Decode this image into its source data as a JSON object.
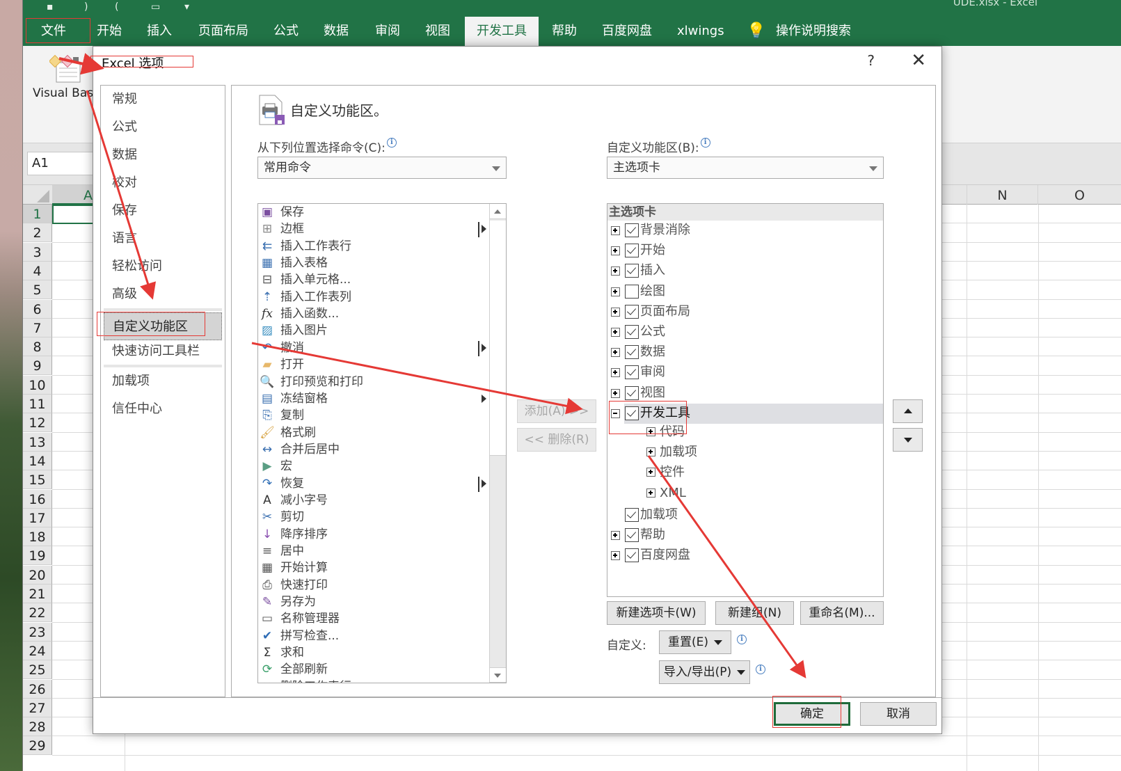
{
  "window": {
    "title_fragment": "UDE.xlsx  -  Excel"
  },
  "ribbon": {
    "tabs": [
      {
        "label": "文件"
      },
      {
        "label": "开始"
      },
      {
        "label": "插入"
      },
      {
        "label": "页面布局"
      },
      {
        "label": "公式"
      },
      {
        "label": "数据"
      },
      {
        "label": "审阅"
      },
      {
        "label": "视图"
      },
      {
        "label": "开发工具",
        "active": true
      },
      {
        "label": "帮助"
      },
      {
        "label": "百度网盘"
      },
      {
        "label": "xlwings"
      }
    ],
    "tell_me": "操作说明搜索",
    "visual_basic_label": "Visual Basi"
  },
  "sheet": {
    "name_box": "A1",
    "columns_left": [
      "A"
    ],
    "columns_right": [
      "N",
      "O"
    ],
    "rows": [
      "1",
      "2",
      "3",
      "4",
      "5",
      "6",
      "7",
      "8",
      "9",
      "10",
      "11",
      "12",
      "13",
      "14",
      "15",
      "16",
      "17",
      "18",
      "19",
      "20",
      "21",
      "22",
      "23",
      "24",
      "25",
      "26",
      "27",
      "28",
      "29"
    ]
  },
  "dialog": {
    "title": "Excel 选项",
    "help": "?",
    "close": "✕",
    "nav": [
      {
        "label": "常规"
      },
      {
        "label": "公式"
      },
      {
        "label": "数据"
      },
      {
        "label": "校对"
      },
      {
        "label": "保存"
      },
      {
        "label": "语言"
      },
      {
        "label": "轻松访问"
      },
      {
        "label": "高级"
      },
      {
        "label": "自定义功能区",
        "active": true
      },
      {
        "label": "快速访问工具栏"
      },
      {
        "label": "加载项"
      },
      {
        "label": "信任中心"
      }
    ],
    "section_title": "自定义功能区。",
    "choose_commands_label": "从下列位置选择命令(C):",
    "choose_commands_value": "常用命令",
    "customize_ribbon_label": "自定义功能区(B):",
    "customize_ribbon_value": "主选项卡",
    "commands": [
      {
        "label": "保存",
        "icon": "save-icon",
        "glyph": "▣",
        "color": "#7b4fa0"
      },
      {
        "label": "边框",
        "icon": "borders-icon",
        "glyph": "⊞",
        "color": "#888",
        "submenu": "bar"
      },
      {
        "label": "插入工作表行",
        "icon": "insert-row-icon",
        "glyph": "⇇",
        "color": "#3a6fb0"
      },
      {
        "label": "插入表格",
        "icon": "insert-table-icon",
        "glyph": "▦",
        "color": "#3a6fb0"
      },
      {
        "label": "插入单元格...",
        "icon": "insert-cells-icon",
        "glyph": "⊟",
        "color": "#555"
      },
      {
        "label": "插入工作表列",
        "icon": "insert-column-icon",
        "glyph": "⇡",
        "color": "#3a6fb0"
      },
      {
        "label": "插入函数...",
        "icon": "function-icon",
        "glyph": "fx",
        "color": "#333"
      },
      {
        "label": "插入图片",
        "icon": "picture-icon",
        "glyph": "▨",
        "color": "#3a8fc0"
      },
      {
        "label": "撤消",
        "icon": "undo-icon",
        "glyph": "↶",
        "color": "#2f6db5",
        "submenu": "bar"
      },
      {
        "label": "打开",
        "icon": "folder-icon",
        "glyph": "▰",
        "color": "#e7b86a"
      },
      {
        "label": "打印预览和打印",
        "icon": "print-preview-icon",
        "glyph": "🔍",
        "color": "#555"
      },
      {
        "label": "冻结窗格",
        "icon": "freeze-panes-icon",
        "glyph": "▤",
        "color": "#3a6fb0",
        "submenu": "plain"
      },
      {
        "label": "复制",
        "icon": "copy-icon",
        "glyph": "⎘",
        "color": "#3a6fb0"
      },
      {
        "label": "格式刷",
        "icon": "format-painter-icon",
        "glyph": "🖌",
        "color": "#d9a84d"
      },
      {
        "label": "合并后居中",
        "icon": "merge-center-icon",
        "glyph": "↔",
        "color": "#3a6fb0"
      },
      {
        "label": "宏",
        "icon": "macro-icon",
        "glyph": "▶",
        "color": "#5b9e84"
      },
      {
        "label": "恢复",
        "icon": "redo-icon",
        "glyph": "↷",
        "color": "#2f6db5",
        "submenu": "bar"
      },
      {
        "label": "减小字号",
        "icon": "decrease-font-icon",
        "glyph": "A",
        "color": "#333"
      },
      {
        "label": "剪切",
        "icon": "cut-icon",
        "glyph": "✂",
        "color": "#3a6fb0"
      },
      {
        "label": "降序排序",
        "icon": "sort-desc-icon",
        "glyph": "↓",
        "color": "#8a4fb0"
      },
      {
        "label": "居中",
        "icon": "align-center-icon",
        "glyph": "≡",
        "color": "#555"
      },
      {
        "label": "开始计算",
        "icon": "calculator-icon",
        "glyph": "▦",
        "color": "#555"
      },
      {
        "label": "快速打印",
        "icon": "quick-print-icon",
        "glyph": "⎙",
        "color": "#555"
      },
      {
        "label": "另存为",
        "icon": "save-as-icon",
        "glyph": "✎",
        "color": "#7b4fa0"
      },
      {
        "label": "名称管理器",
        "icon": "name-manager-icon",
        "glyph": "▭",
        "color": "#555"
      },
      {
        "label": "拼写检查...",
        "icon": "spelling-icon",
        "glyph": "✔",
        "color": "#2f6db5"
      },
      {
        "label": "求和",
        "icon": "sum-icon",
        "glyph": "Σ",
        "color": "#333"
      },
      {
        "label": "全部刷新",
        "icon": "refresh-all-icon",
        "glyph": "⟳",
        "color": "#3a9f6a"
      },
      {
        "label": "删除工作表行",
        "icon": "delete-row-icon",
        "glyph": "✕",
        "color": "#c0392b"
      }
    ],
    "add_button": "添加(A) >>",
    "remove_button": "<< 删除(R)",
    "tree_header": "主选项卡",
    "tree": [
      {
        "label": "背景消除",
        "checked": true,
        "expander": "plus",
        "level": 0
      },
      {
        "label": "开始",
        "checked": true,
        "expander": "plus",
        "level": 0
      },
      {
        "label": "插入",
        "checked": true,
        "expander": "plus",
        "level": 0
      },
      {
        "label": "绘图",
        "checked": false,
        "expander": "plus",
        "level": 0
      },
      {
        "label": "页面布局",
        "checked": true,
        "expander": "plus",
        "level": 0
      },
      {
        "label": "公式",
        "checked": true,
        "expander": "plus",
        "level": 0
      },
      {
        "label": "数据",
        "checked": true,
        "expander": "plus",
        "level": 0
      },
      {
        "label": "审阅",
        "checked": true,
        "expander": "plus",
        "level": 0
      },
      {
        "label": "视图",
        "checked": true,
        "expander": "plus",
        "level": 0
      },
      {
        "label": "开发工具",
        "checked": true,
        "expander": "minus",
        "level": 0,
        "selected": true
      },
      {
        "label": "代码",
        "expander": "plus",
        "level": 1
      },
      {
        "label": "加载项",
        "expander": "plus",
        "level": 1
      },
      {
        "label": "控件",
        "expander": "plus",
        "level": 1
      },
      {
        "label": "XML",
        "expander": "plus",
        "level": 1
      },
      {
        "label": "加载项",
        "checked": true,
        "expander": "none",
        "level": 0
      },
      {
        "label": "帮助",
        "checked": true,
        "expander": "plus",
        "level": 0
      },
      {
        "label": "百度网盘",
        "checked": true,
        "expander": "plus",
        "level": 0
      }
    ],
    "new_tab_button": "新建选项卡(W)",
    "new_group_button": "新建组(N)",
    "rename_button": "重命名(M)...",
    "customizations_label": "自定义:",
    "reset_button": "重置(E)",
    "import_export_button": "导入/导出(P)",
    "ok_button": "确定",
    "cancel_button": "取消"
  },
  "colors": {
    "excel_green": "#217346",
    "annotation_red": "#e53935",
    "ok_border": "#1e6b3a"
  }
}
